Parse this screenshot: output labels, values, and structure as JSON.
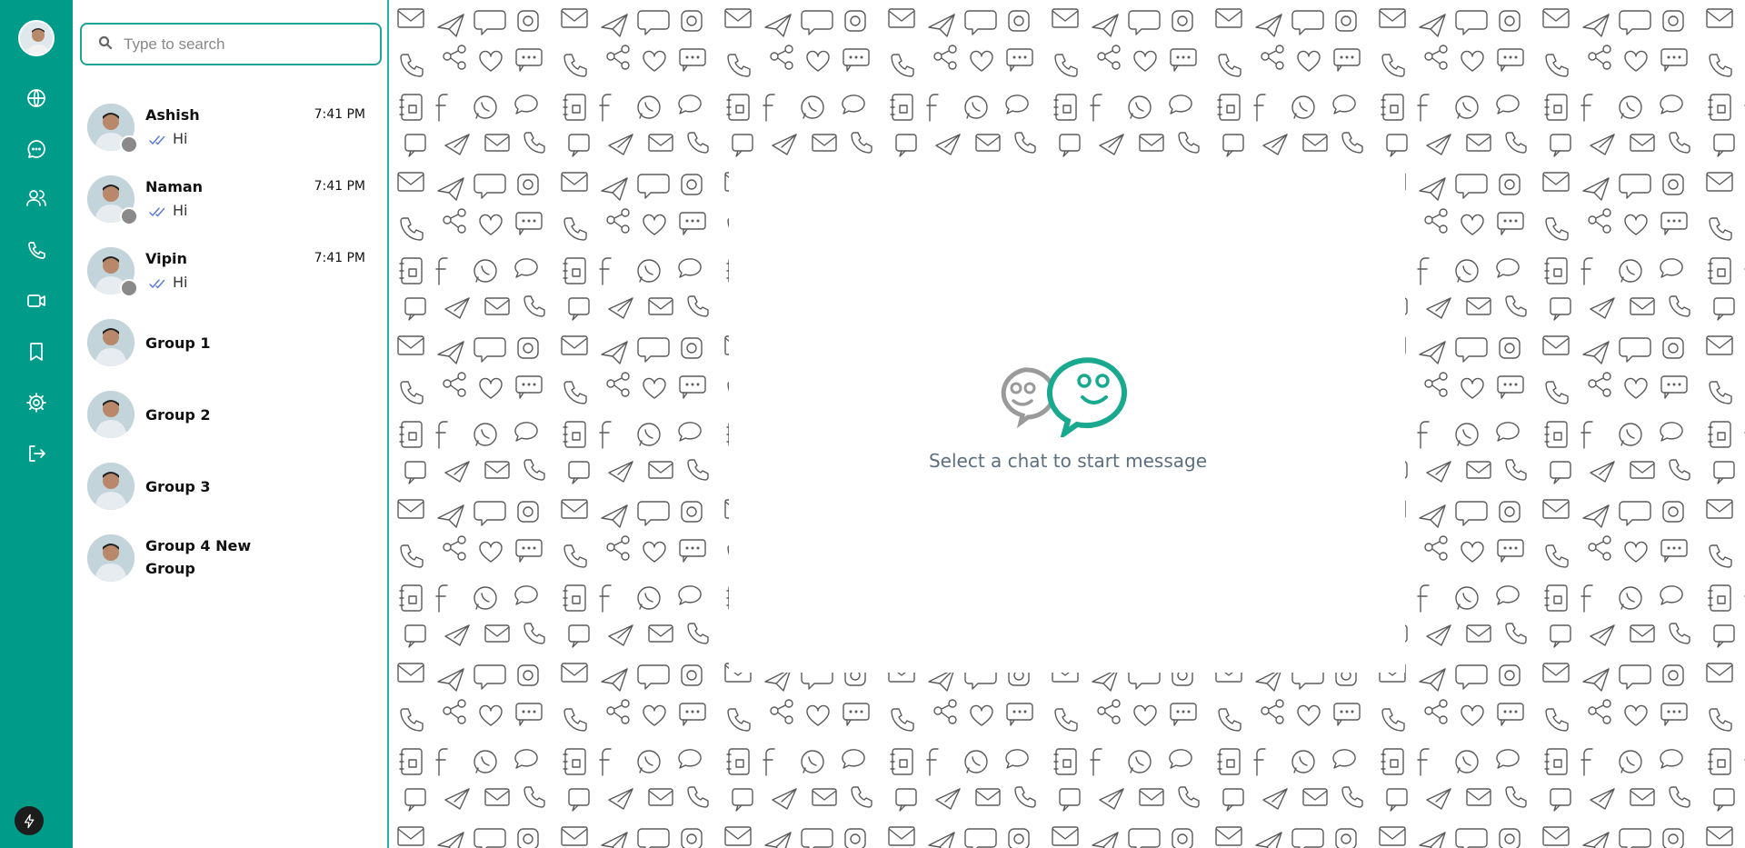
{
  "search": {
    "placeholder": "Type to search",
    "value": ""
  },
  "nav": {
    "items": [
      {
        "name": "globe",
        "label": "globe-icon"
      },
      {
        "name": "chats",
        "label": "chat-bubble-icon"
      },
      {
        "name": "contacts",
        "label": "users-icon"
      },
      {
        "name": "calls",
        "label": "phone-icon"
      },
      {
        "name": "video",
        "label": "video-icon"
      },
      {
        "name": "saved",
        "label": "bookmark-icon"
      },
      {
        "name": "settings",
        "label": "gear-icon"
      },
      {
        "name": "logout",
        "label": "logout-icon"
      }
    ]
  },
  "chats": [
    {
      "name": "Ashish",
      "time": "7:41 PM",
      "preview": "Hi"
    },
    {
      "name": "Naman",
      "time": "7:41 PM",
      "preview": "Hi"
    },
    {
      "name": "Vipin",
      "time": "7:41 PM",
      "preview": "Hi"
    },
    {
      "name": "Group 1"
    },
    {
      "name": "Group 2"
    },
    {
      "name": "Group 3"
    },
    {
      "name": "Group 4 New Group"
    }
  ],
  "empty_state": {
    "message": "Select a chat to start message"
  },
  "colors": {
    "rail": "#019b8a",
    "accent": "#1fb5a4",
    "status_offline": "#8a8a8a",
    "read_check": "#5b7bdb"
  }
}
